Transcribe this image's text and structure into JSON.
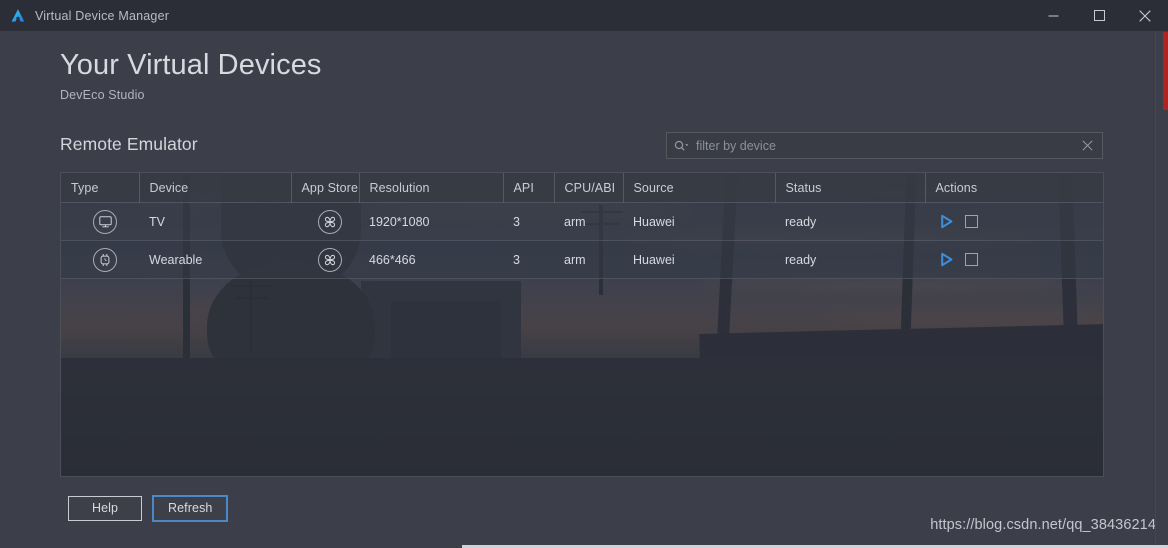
{
  "window": {
    "title": "Virtual Device Manager",
    "logo_icon": "deveco-studio-logo-icon",
    "minimize_label": "Minimize",
    "maximize_label": "Maximize",
    "close_label": "Close"
  },
  "header": {
    "title": "Your Virtual Devices",
    "subtitle": "DevEco Studio"
  },
  "section": {
    "title": "Remote Emulator"
  },
  "search": {
    "placeholder": "filter by device",
    "value": "",
    "icon": "search-icon",
    "clear_icon": "close-icon"
  },
  "table": {
    "columns": [
      "Type",
      "Device",
      "App Store",
      "Resolution",
      "API",
      "CPU/ABI",
      "Source",
      "Status",
      "Actions"
    ],
    "rows": [
      {
        "type_icon": "tv-icon",
        "device": "TV",
        "app_store_icon": "appgallery-icon",
        "resolution": "1920*1080",
        "api": "3",
        "cpu_abi": "arm",
        "source": "Huawei",
        "status": "ready",
        "actions": [
          "play-icon",
          "stop-icon"
        ]
      },
      {
        "type_icon": "watch-icon",
        "device": "Wearable",
        "app_store_icon": "appgallery-icon",
        "resolution": "466*466",
        "api": "3",
        "cpu_abi": "arm",
        "source": "Huawei",
        "status": "ready",
        "actions": [
          "play-icon",
          "stop-icon"
        ]
      }
    ]
  },
  "footer": {
    "help_label": "Help",
    "refresh_label": "Refresh"
  },
  "watermark": {
    "text": "https://blog.csdn.net/qq_38436214"
  },
  "colors": {
    "accent": "#3f8fd8",
    "titlebar": "#2b2d37",
    "body": "#3c3f4a",
    "scroll_marker": "#b0231f"
  }
}
